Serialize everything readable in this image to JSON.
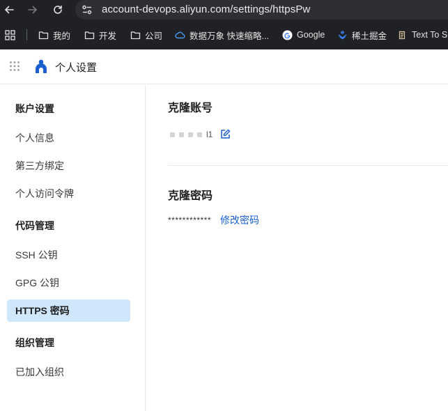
{
  "browser": {
    "url": "account-devops.aliyun.com/settings/httpsPw",
    "bookmarks": [
      {
        "label": "我的",
        "icon": "folder-icon"
      },
      {
        "label": "开发",
        "icon": "folder-icon"
      },
      {
        "label": "公司",
        "icon": "folder-icon"
      },
      {
        "label": "数据万象 快速缩略...",
        "icon": "cloud-icon"
      },
      {
        "label": "Google",
        "icon": "google-icon"
      },
      {
        "label": "稀土掘金",
        "icon": "juejin-icon"
      },
      {
        "label": "Text To S",
        "icon": "scroll-icon"
      }
    ]
  },
  "app": {
    "title": "个人设置"
  },
  "sidebar": {
    "groups": [
      {
        "label": "账户设置",
        "items": [
          {
            "label": "个人信息"
          },
          {
            "label": "第三方绑定"
          },
          {
            "label": "个人访问令牌"
          }
        ]
      },
      {
        "label": "代码管理",
        "items": [
          {
            "label": "SSH 公钥"
          },
          {
            "label": "GPG 公钥"
          },
          {
            "label": "HTTPS 密码"
          }
        ]
      },
      {
        "label": "组织管理",
        "items": [
          {
            "label": "已加入组织"
          }
        ]
      }
    ],
    "active_item": "HTTPS 密码"
  },
  "main": {
    "account_section_title": "克隆账号",
    "account_value_tail": "l1",
    "password_section_title": "克隆密码",
    "password_mask": "************",
    "change_password_label": "修改密码"
  },
  "colors": {
    "link": "#1b5fcf",
    "active_bg": "#cfe6fb",
    "chrome_bg": "#202124"
  }
}
